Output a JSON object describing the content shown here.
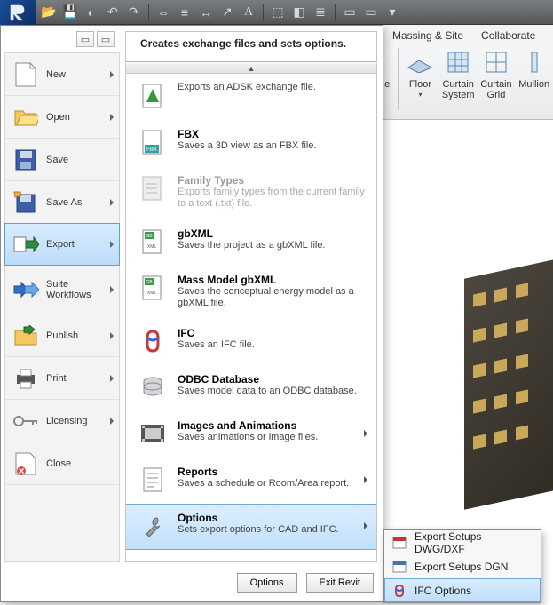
{
  "qat": {
    "icons": [
      "open",
      "save",
      "undo",
      "undo-arrow",
      "redo",
      "sync",
      "add",
      "rect",
      "dimension",
      "text-a",
      "3d",
      "cube",
      "section",
      "align",
      "win1",
      "win2",
      "dropdown"
    ]
  },
  "ribbon": {
    "tabs": [
      "Massing & Site",
      "Collaborate"
    ],
    "panel": [
      {
        "label_a": "",
        "label_b": "e"
      },
      {
        "label_a": "Floor",
        "label_b": ""
      },
      {
        "label_a": "Curtain",
        "label_b": "System"
      },
      {
        "label_a": "Curtain",
        "label_b": "Grid"
      },
      {
        "label_a": "Mullion",
        "label_b": ""
      }
    ]
  },
  "left_menu": [
    {
      "id": "new",
      "label": "New",
      "has_arrow": true
    },
    {
      "id": "open",
      "label": "Open",
      "has_arrow": true
    },
    {
      "id": "save",
      "label": "Save",
      "has_arrow": false
    },
    {
      "id": "saveas",
      "label": "Save As",
      "has_arrow": true
    },
    {
      "id": "export",
      "label": "Export",
      "has_arrow": true,
      "selected": true
    },
    {
      "id": "suite",
      "label": "Suite Workflows",
      "has_arrow": true
    },
    {
      "id": "publish",
      "label": "Publish",
      "has_arrow": true
    },
    {
      "id": "print",
      "label": "Print",
      "has_arrow": true
    },
    {
      "id": "licensing",
      "label": "Licensing",
      "has_arrow": true
    },
    {
      "id": "close",
      "label": "Close",
      "has_arrow": false
    }
  ],
  "submenu": {
    "header": "Creates exchange files and sets options.",
    "items": [
      {
        "id": "adsk",
        "title": "",
        "desc": "Exports an ADSK exchange file.",
        "icon": "adsk",
        "disabled": false
      },
      {
        "id": "fbx",
        "title": "FBX",
        "desc": "Saves a 3D view as an FBX file.",
        "icon": "fbx"
      },
      {
        "id": "famtypes",
        "title": "Family Types",
        "desc": "Exports family types from the current family to a text (.txt) file.",
        "icon": "famtypes",
        "disabled": true
      },
      {
        "id": "gbxml",
        "title": "gbXML",
        "desc": "Saves the project as a gbXML file.",
        "icon": "gbxml"
      },
      {
        "id": "massgb",
        "title": "Mass Model gbXML",
        "desc": "Saves the conceptual energy model as a gbXML file.",
        "icon": "gbxml"
      },
      {
        "id": "ifc",
        "title": "IFC",
        "desc": "Saves an IFC file.",
        "icon": "ifc"
      },
      {
        "id": "odbc",
        "title": "ODBC Database",
        "desc": "Saves model data to an ODBC database.",
        "icon": "odbc"
      },
      {
        "id": "imganim",
        "title": "Images and Animations",
        "desc": "Saves animations or image files.",
        "icon": "film",
        "has_arrow": true
      },
      {
        "id": "reports",
        "title": "Reports",
        "desc": "Saves a schedule or Room/Area report.",
        "icon": "report",
        "has_arrow": true
      },
      {
        "id": "options",
        "title": "Options",
        "desc": "Sets export options for CAD and IFC.",
        "icon": "wrench",
        "has_arrow": true,
        "highlight": true
      }
    ]
  },
  "bottom": {
    "options": "Options",
    "exit": "Exit Revit"
  },
  "flyout": [
    {
      "id": "dwgdxf",
      "label": "Export Setups DWG/DXF",
      "icon": "dwg"
    },
    {
      "id": "dgn",
      "label": "Export Setups DGN",
      "icon": "dgn"
    },
    {
      "id": "ifcopt",
      "label": "IFC Options",
      "icon": "ifc",
      "highlight": true
    }
  ]
}
